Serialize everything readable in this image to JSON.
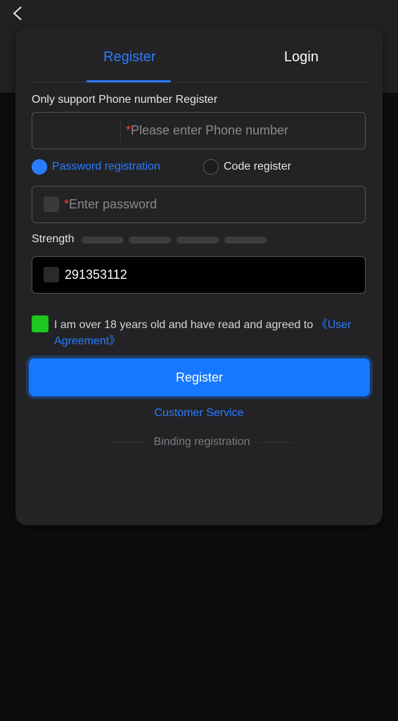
{
  "header": {
    "back_icon": "chevron-left-icon"
  },
  "tabs": {
    "register": "Register",
    "login": "Login"
  },
  "form": {
    "hint": "Only support Phone number Register",
    "phone": {
      "required_mark": "*",
      "placeholder": "Please enter Phone number"
    },
    "mode": {
      "password_option": "Password registration",
      "code_option": "Code register",
      "selected": "password"
    },
    "password": {
      "required_mark": "*",
      "placeholder": "Enter password"
    },
    "strength": {
      "label": "Strength",
      "level": 0,
      "segments": 4
    },
    "invite_code": {
      "value": "291353112"
    },
    "agreement": {
      "checked": true,
      "text": "I am over 18 years old and have read and agreed to ",
      "link": "《User Agreement》"
    },
    "submit_label": "Register"
  },
  "footer": {
    "customer_service": "Customer Service",
    "binding_registration": "Binding registration"
  },
  "colors": {
    "accent": "#2a7cff",
    "check_green": "#1ec81e",
    "required_red": "#ff3b30"
  }
}
